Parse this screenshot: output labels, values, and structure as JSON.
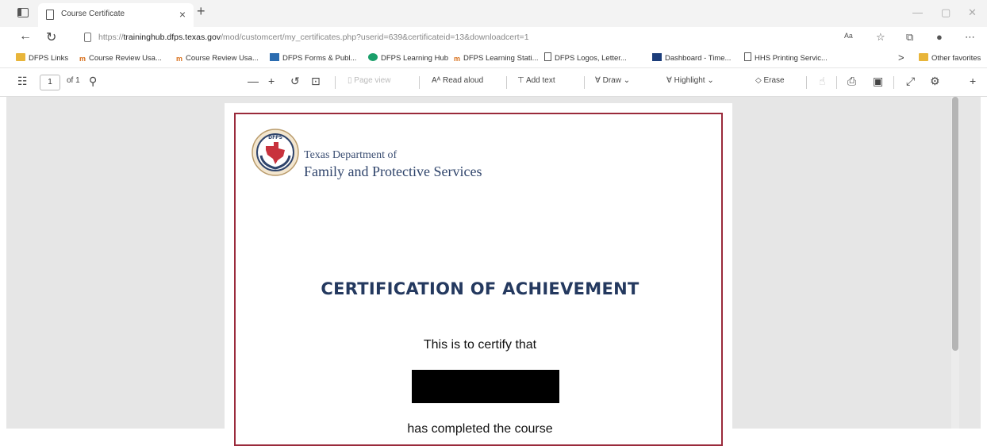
{
  "window": {
    "tab_title": "Course Certificate",
    "tab_close": "×",
    "new_tab": "+",
    "minimize": "—",
    "maximize": "▢",
    "close": "✕"
  },
  "address": {
    "back": "←",
    "refresh": "↻",
    "url_prefix": "https://",
    "url_host": "traininghub.dfps.texas.gov",
    "url_path": "/mod/customcert/my_certificates.php?userid=639&certificateid=13&downloadcert=1"
  },
  "favorites": {
    "items": [
      {
        "label": "DFPS Links",
        "icon": "folder-icon"
      },
      {
        "label": "Course Review Usa...",
        "icon": "moodle-icon"
      },
      {
        "label": "Course Review Usa...",
        "icon": "moodle-icon"
      },
      {
        "label": "DFPS Forms & Publ...",
        "icon": "table-icon"
      },
      {
        "label": "DFPS Learning Hub",
        "icon": "globe-icon"
      },
      {
        "label": "DFPS Learning Stati...",
        "icon": "moodle-icon"
      },
      {
        "label": "DFPS Logos, Letter...",
        "icon": "page-icon"
      },
      {
        "label": "Dashboard - Time...",
        "icon": "dashboard-icon"
      },
      {
        "label": "HHS Printing Servic...",
        "icon": "page-icon"
      }
    ],
    "more": ">",
    "other": "Other favorites"
  },
  "pdf_toolbar": {
    "page": "1",
    "of": "of 1",
    "zoom_out": "—",
    "zoom_in": "+",
    "page_view": "Page view",
    "read_aloud": "Read aloud",
    "add_text": "Add text",
    "draw": "Draw",
    "highlight": "Highlight",
    "erase": "Erase"
  },
  "certificate": {
    "agency_line1": "Texas Department of",
    "agency_line2": "Family and Protective Services",
    "seal_text": "DFPS",
    "title": "CERTIFICATION OF ACHIEVEMENT",
    "certify": "This is to certify that",
    "completed": "has completed the course"
  },
  "colors": {
    "border": "#9a2a3b",
    "title": "#24395f",
    "seal_red": "#c8323d",
    "seal_blue": "#2f446b"
  }
}
